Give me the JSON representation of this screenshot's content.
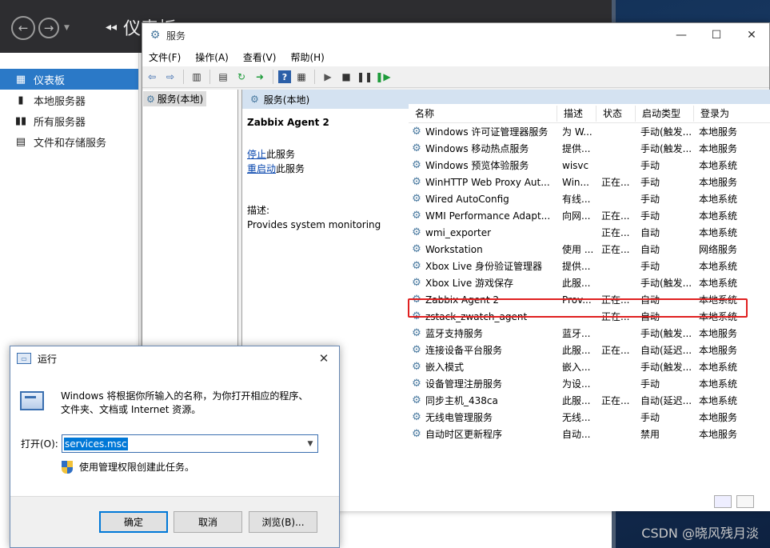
{
  "server_manager": {
    "title": "仪表板",
    "sidebar": [
      {
        "label": "仪表板",
        "icon": "dashboard-icon"
      },
      {
        "label": "本地服务器",
        "icon": "server-icon"
      },
      {
        "label": "所有服务器",
        "icon": "servers-icon"
      },
      {
        "label": "文件和存储服务",
        "icon": "storage-icon"
      }
    ]
  },
  "services": {
    "window_title": "服务",
    "menu": [
      "文件(F)",
      "操作(A)",
      "查看(V)",
      "帮助(H)"
    ],
    "tree_item": "服务(本地)",
    "pane_header": "服务(本地)",
    "detail": {
      "name": "Zabbix Agent 2",
      "stop_link": "停止",
      "stop_suffix": "此服务",
      "restart_link": "重启动",
      "restart_suffix": "此服务",
      "desc_label": "描述:",
      "desc_text": "Provides system monitoring"
    },
    "columns": [
      "名称",
      "描述",
      "状态",
      "启动类型",
      "登录为"
    ],
    "rows": [
      {
        "name": "Windows 许可证管理器服务",
        "desc": "为 W...",
        "status": "",
        "start": "手动(触发...",
        "logon": "本地服务"
      },
      {
        "name": "Windows 移动热点服务",
        "desc": "提供...",
        "status": "",
        "start": "手动(触发...",
        "logon": "本地服务"
      },
      {
        "name": "Windows 预览体验服务",
        "desc": "wisvc",
        "status": "",
        "start": "手动",
        "logon": "本地系统"
      },
      {
        "name": "WinHTTP Web Proxy Aut...",
        "desc": "Win...",
        "status": "正在...",
        "start": "手动",
        "logon": "本地服务"
      },
      {
        "name": "Wired AutoConfig",
        "desc": "有线...",
        "status": "",
        "start": "手动",
        "logon": "本地系统"
      },
      {
        "name": "WMI Performance Adapt...",
        "desc": "向网...",
        "status": "正在...",
        "start": "手动",
        "logon": "本地系统"
      },
      {
        "name": "wmi_exporter",
        "desc": "",
        "status": "正在...",
        "start": "自动",
        "logon": "本地系统"
      },
      {
        "name": "Workstation",
        "desc": "使用 ...",
        "status": "正在...",
        "start": "自动",
        "logon": "网络服务"
      },
      {
        "name": "Xbox Live 身份验证管理器",
        "desc": "提供...",
        "status": "",
        "start": "手动",
        "logon": "本地系统"
      },
      {
        "name": "Xbox Live 游戏保存",
        "desc": "此服...",
        "status": "",
        "start": "手动(触发...",
        "logon": "本地系统"
      },
      {
        "name": "Zabbix Agent 2",
        "desc": "Prov...",
        "status": "正在...",
        "start": "自动",
        "logon": "本地系统"
      },
      {
        "name": "zstack_zwatch_agent",
        "desc": "",
        "status": "正在...",
        "start": "自动",
        "logon": "本地系统"
      },
      {
        "name": "蓝牙支持服务",
        "desc": "蓝牙...",
        "status": "",
        "start": "手动(触发...",
        "logon": "本地服务"
      },
      {
        "name": "连接设备平台服务",
        "desc": "此服...",
        "status": "正在...",
        "start": "自动(延迟...",
        "logon": "本地服务"
      },
      {
        "name": "嵌入模式",
        "desc": "嵌入...",
        "status": "",
        "start": "手动(触发...",
        "logon": "本地系统"
      },
      {
        "name": "设备管理注册服务",
        "desc": "为设...",
        "status": "",
        "start": "手动",
        "logon": "本地系统"
      },
      {
        "name": "同步主机_438ca",
        "desc": "此服...",
        "status": "正在...",
        "start": "自动(延迟...",
        "logon": "本地系统"
      },
      {
        "name": "无线电管理服务",
        "desc": "无线...",
        "status": "",
        "start": "手动",
        "logon": "本地服务"
      },
      {
        "name": "自动时区更新程序",
        "desc": "自动...",
        "status": "",
        "start": "禁用",
        "logon": "本地服务"
      }
    ]
  },
  "run_dialog": {
    "title": "运行",
    "message_line1": "Windows 将根据你所输入的名称，为你打开相应的程序、",
    "message_line2": "文件夹、文档或 Internet 资源。",
    "open_label": "打开(O):",
    "input_value": "services.msc",
    "admin_text": "使用管理权限创建此任务。",
    "ok_label": "确定",
    "cancel_label": "取消",
    "browse_label": "浏览(B)..."
  },
  "watermark": "CSDN @晓风残月淡"
}
